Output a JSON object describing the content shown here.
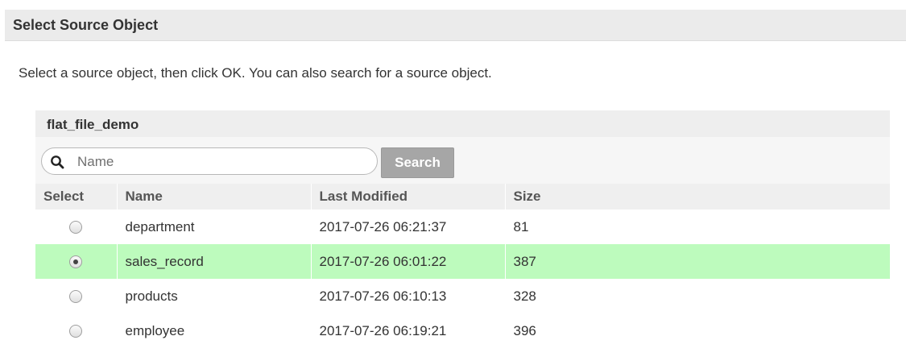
{
  "dialog": {
    "title": "Select Source Object",
    "instructions": "Select a source object, then click OK. You can also search for a source object."
  },
  "browser": {
    "folder_name": "flat_file_demo",
    "search": {
      "placeholder": "Name",
      "value": "",
      "button_label": "Search",
      "icon": "search-icon"
    },
    "columns": {
      "select": "Select",
      "name": "Name",
      "last_modified": "Last Modified",
      "size": "Size"
    },
    "rows": [
      {
        "name": "department",
        "last_modified": "2017-07-26 06:21:37",
        "size": "81",
        "selected": false
      },
      {
        "name": "sales_record",
        "last_modified": "2017-07-26 06:01:22",
        "size": "387",
        "selected": true
      },
      {
        "name": "products",
        "last_modified": "2017-07-26 06:10:13",
        "size": "328",
        "selected": false
      },
      {
        "name": "employee",
        "last_modified": "2017-07-26 06:19:21",
        "size": "396",
        "selected": false
      }
    ]
  },
  "colors": {
    "selected_row": "#bdfbbd",
    "header_bg": "#ebebeb",
    "search_button": "#a6a6a6"
  }
}
